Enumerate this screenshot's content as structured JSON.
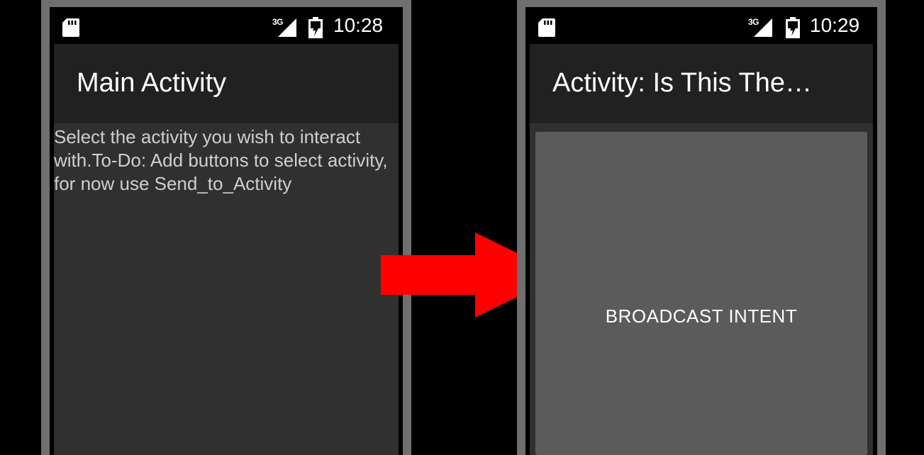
{
  "left_phone": {
    "status_bar": {
      "network": "3G",
      "time": "10:28",
      "icons": [
        "sd-card-icon",
        "signal-icon",
        "battery-charging-icon"
      ]
    },
    "appbar_title": "Main Activity",
    "body_text": "Select the activity you wish to interact with.To-Do: Add buttons to select activity, for now use Send_to_Activity"
  },
  "right_phone": {
    "status_bar": {
      "network": "3G",
      "time": "10:29",
      "icons": [
        "sd-card-icon",
        "signal-icon",
        "battery-charging-icon"
      ]
    },
    "appbar_title": "Activity: Is This The…",
    "button_label": "BROADCAST INTENT"
  },
  "arrow": {
    "color": "#ff0000",
    "icon": "right-arrow-icon"
  },
  "colors": {
    "phone_bezel": "#6f6f6f",
    "appbar": "#212121",
    "screen": "#303030",
    "button": "#5b5b5c"
  }
}
